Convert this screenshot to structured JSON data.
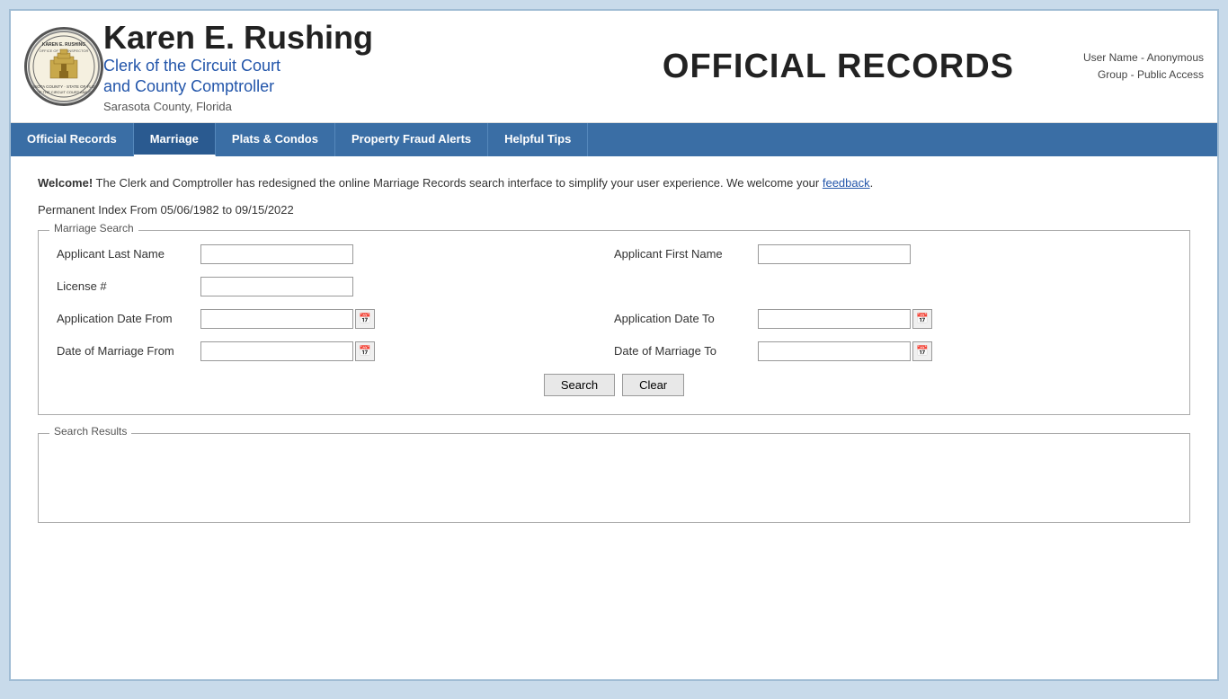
{
  "header": {
    "clerk_name": "Karen E. Rushing",
    "clerk_subtitle_line1": "Clerk of the Circuit Court",
    "clerk_subtitle_line2": "and County Comptroller",
    "county": "Sarasota County, Florida",
    "page_title": "OFFICIAL RECORDS",
    "user_name_label": "User Name - Anonymous",
    "group_label": "Group - Public Access"
  },
  "nav": {
    "items": [
      {
        "label": "Official Records",
        "active": false
      },
      {
        "label": "Marriage",
        "active": true
      },
      {
        "label": "Plats & Condos",
        "active": false
      },
      {
        "label": "Property Fraud Alerts",
        "active": false
      },
      {
        "label": "Helpful Tips",
        "active": false
      }
    ]
  },
  "main": {
    "welcome_bold": "Welcome!",
    "welcome_text": " The Clerk and Comptroller has redesigned the online Marriage Records search interface to simplify your user experience. We welcome your ",
    "feedback_link": "feedback",
    "welcome_end": ".",
    "permanent_index": "Permanent Index From 05/06/1982 to 09/15/2022",
    "marriage_search_legend": "Marriage Search",
    "fields": {
      "applicant_last_name": "Applicant Last Name",
      "applicant_first_name": "Applicant First Name",
      "license_number": "License #",
      "application_date_from": "Application Date From",
      "application_date_to": "Application Date To",
      "date_of_marriage_from": "Date of Marriage From",
      "date_of_marriage_to": "Date of Marriage To"
    },
    "buttons": {
      "search": "Search",
      "clear": "Clear"
    },
    "search_results_legend": "Search Results"
  }
}
